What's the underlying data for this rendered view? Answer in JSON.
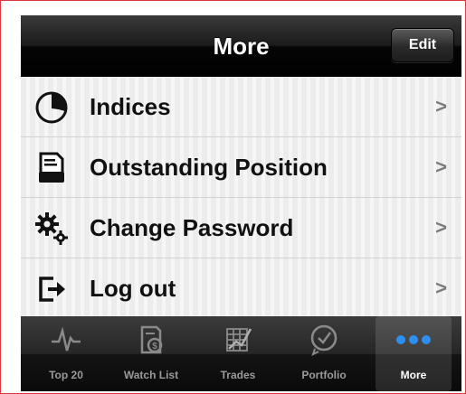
{
  "nav": {
    "title": "More",
    "edit_label": "Edit"
  },
  "menu": [
    {
      "label": "Indices",
      "icon": "pie-chart-icon"
    },
    {
      "label": "Outstanding Position",
      "icon": "document-icon"
    },
    {
      "label": "Change Password",
      "icon": "gears-icon"
    },
    {
      "label": "Log out",
      "icon": "logout-icon"
    }
  ],
  "chevron": ">",
  "tabs": [
    {
      "label": "Top 20",
      "icon": "pulse-icon"
    },
    {
      "label": "Watch List",
      "icon": "watchlist-icon"
    },
    {
      "label": "Trades",
      "icon": "trades-icon"
    },
    {
      "label": "Portfolio",
      "icon": "portfolio-icon"
    },
    {
      "label": "More",
      "icon": "more-dots-icon",
      "active": true
    }
  ],
  "colors": {
    "accent_active_dots": "#2f8ff0",
    "border": "#e0353a"
  }
}
